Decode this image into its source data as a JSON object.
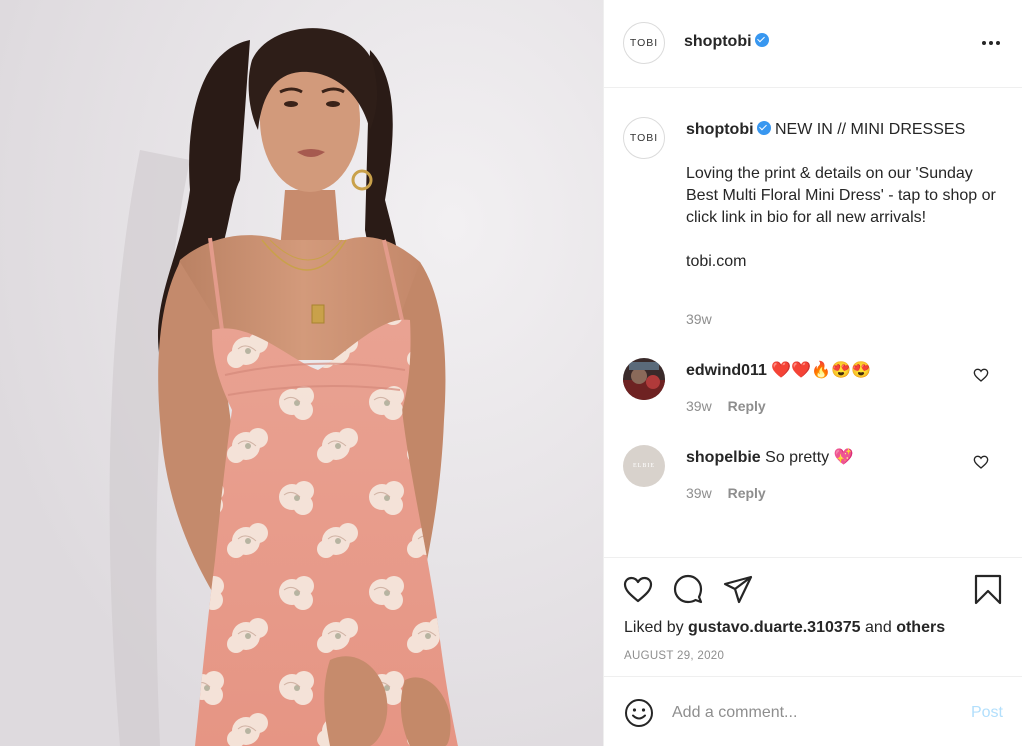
{
  "post": {
    "image_alt": "Model wearing floral mini dress",
    "author": {
      "avatar_text": "TOBI",
      "username": "shoptobi",
      "verified": true
    },
    "caption": {
      "title": "NEW IN // MINI DRESSES",
      "body": "Loving the print & details on our 'Sunday Best Multi Floral Mini Dress' - tap to shop or click link in bio for all new arrivals!",
      "link": "tobi.com",
      "time": "39w"
    },
    "comments": [
      {
        "username": "edwind011",
        "text": "❤️❤️🔥😍😍",
        "time": "39w",
        "reply_label": "Reply"
      },
      {
        "username": "shopelbie",
        "text": "So pretty 💖",
        "time": "39w",
        "reply_label": "Reply"
      }
    ],
    "likes": {
      "prefix": "Liked by",
      "user": "gustavo.duarte.310375",
      "joiner": "and",
      "others": "others"
    },
    "date": "AUGUST 29, 2020",
    "add_comment": {
      "placeholder": "Add a comment...",
      "post_label": "Post"
    }
  },
  "colors": {
    "accent_blue": "#3897f0",
    "post_disabled": "#b2dffc",
    "secondary_text": "#8e8e8e",
    "dress_pink": "#e59a8c"
  },
  "icons": [
    "more-icon",
    "verified-icon",
    "heart-icon",
    "comment-icon",
    "share-icon",
    "bookmark-icon",
    "emoji-icon"
  ]
}
